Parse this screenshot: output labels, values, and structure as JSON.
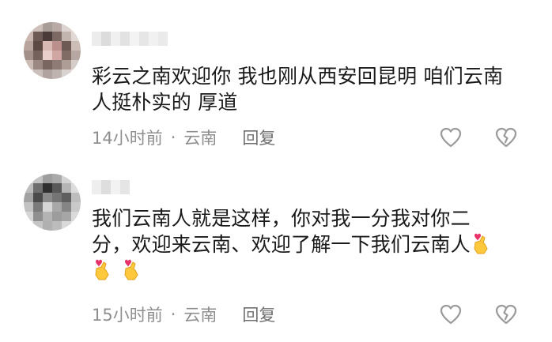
{
  "comments": [
    {
      "text_line1": "彩云之南欢迎你 我也刚从西安回昆明 咱们云南",
      "text_line2": "人挺朴实的  厚道",
      "time": "14小时前",
      "location": "云南",
      "reply_label": "回复",
      "avatar_icon": "pixelated-avatar",
      "username_obscured": true
    },
    {
      "text_line1": "我们云南人就是这样，你对我一分我对你二",
      "text_line2": "分，欢迎来云南、欢迎了解一下我们云南人",
      "emoji_icon": "finger-heart-emoji",
      "time": "15小时前",
      "location": "云南",
      "reply_label": "回复",
      "avatar_icon": "pixelated-avatar",
      "username_obscured": true
    }
  ],
  "meta_separator": "·",
  "colors": {
    "text": "#1a1a1a",
    "meta": "#8f8f8f",
    "icon": "#9a9a9a"
  }
}
